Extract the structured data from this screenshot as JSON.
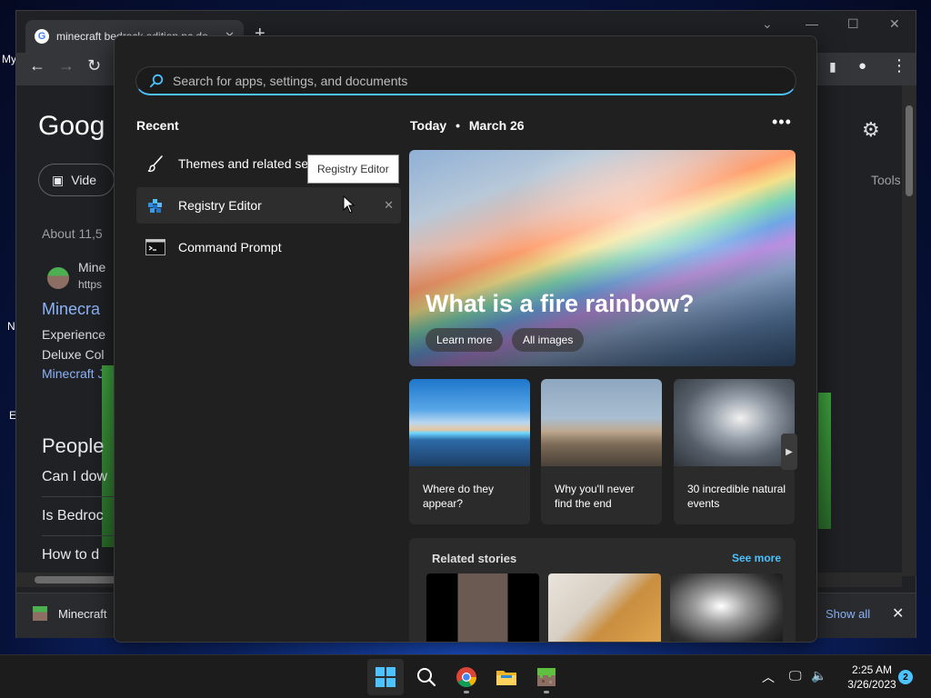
{
  "desktop": {
    "labels": [
      "My",
      "N",
      "E"
    ]
  },
  "browser": {
    "tab_title": "minecraft bedrock edition pc do...",
    "google_logo": "Goog",
    "videos_chip": "Vide",
    "tools_label": "Tools",
    "result_count": "About 11,5",
    "site_name": "Mine",
    "site_url": "https",
    "result_title": "Minecra",
    "snippet_line1": "Experience",
    "snippet_line2": "Deluxe Col",
    "sub_link": "Minecraft J",
    "people_also_ask": "People",
    "questions": [
      "Can I dow",
      "Is Bedroc",
      "How to d"
    ],
    "download_name": "Minecraft",
    "show_all": "Show all"
  },
  "search": {
    "placeholder": "Search for apps, settings, and documents"
  },
  "recent": {
    "title": "Recent",
    "items": [
      {
        "label": "Themes and related settings",
        "icon": "brush-icon"
      },
      {
        "label": "Registry Editor",
        "icon": "registry-editor-icon"
      },
      {
        "label": "Command Prompt",
        "icon": "command-prompt-icon"
      }
    ],
    "tooltip": "Registry Editor"
  },
  "today": {
    "label": "Today",
    "separator": "•",
    "date": "March 26",
    "hero_title": "What is a fire rainbow?",
    "learn_more": "Learn more",
    "all_images": "All images",
    "cards": [
      {
        "caption": "Where do they appear?"
      },
      {
        "caption": "Why you'll never find the end"
      },
      {
        "caption": "30 incredible natural events"
      }
    ],
    "related_title": "Related stories",
    "see_more": "See more"
  },
  "taskbar": {
    "time": "2:25 AM",
    "date": "3/26/2023",
    "notifications": "2"
  },
  "colors": {
    "accent": "#4cc2ff",
    "panel_bg": "#202020",
    "taskbar_bg": "#1c1c1c"
  }
}
